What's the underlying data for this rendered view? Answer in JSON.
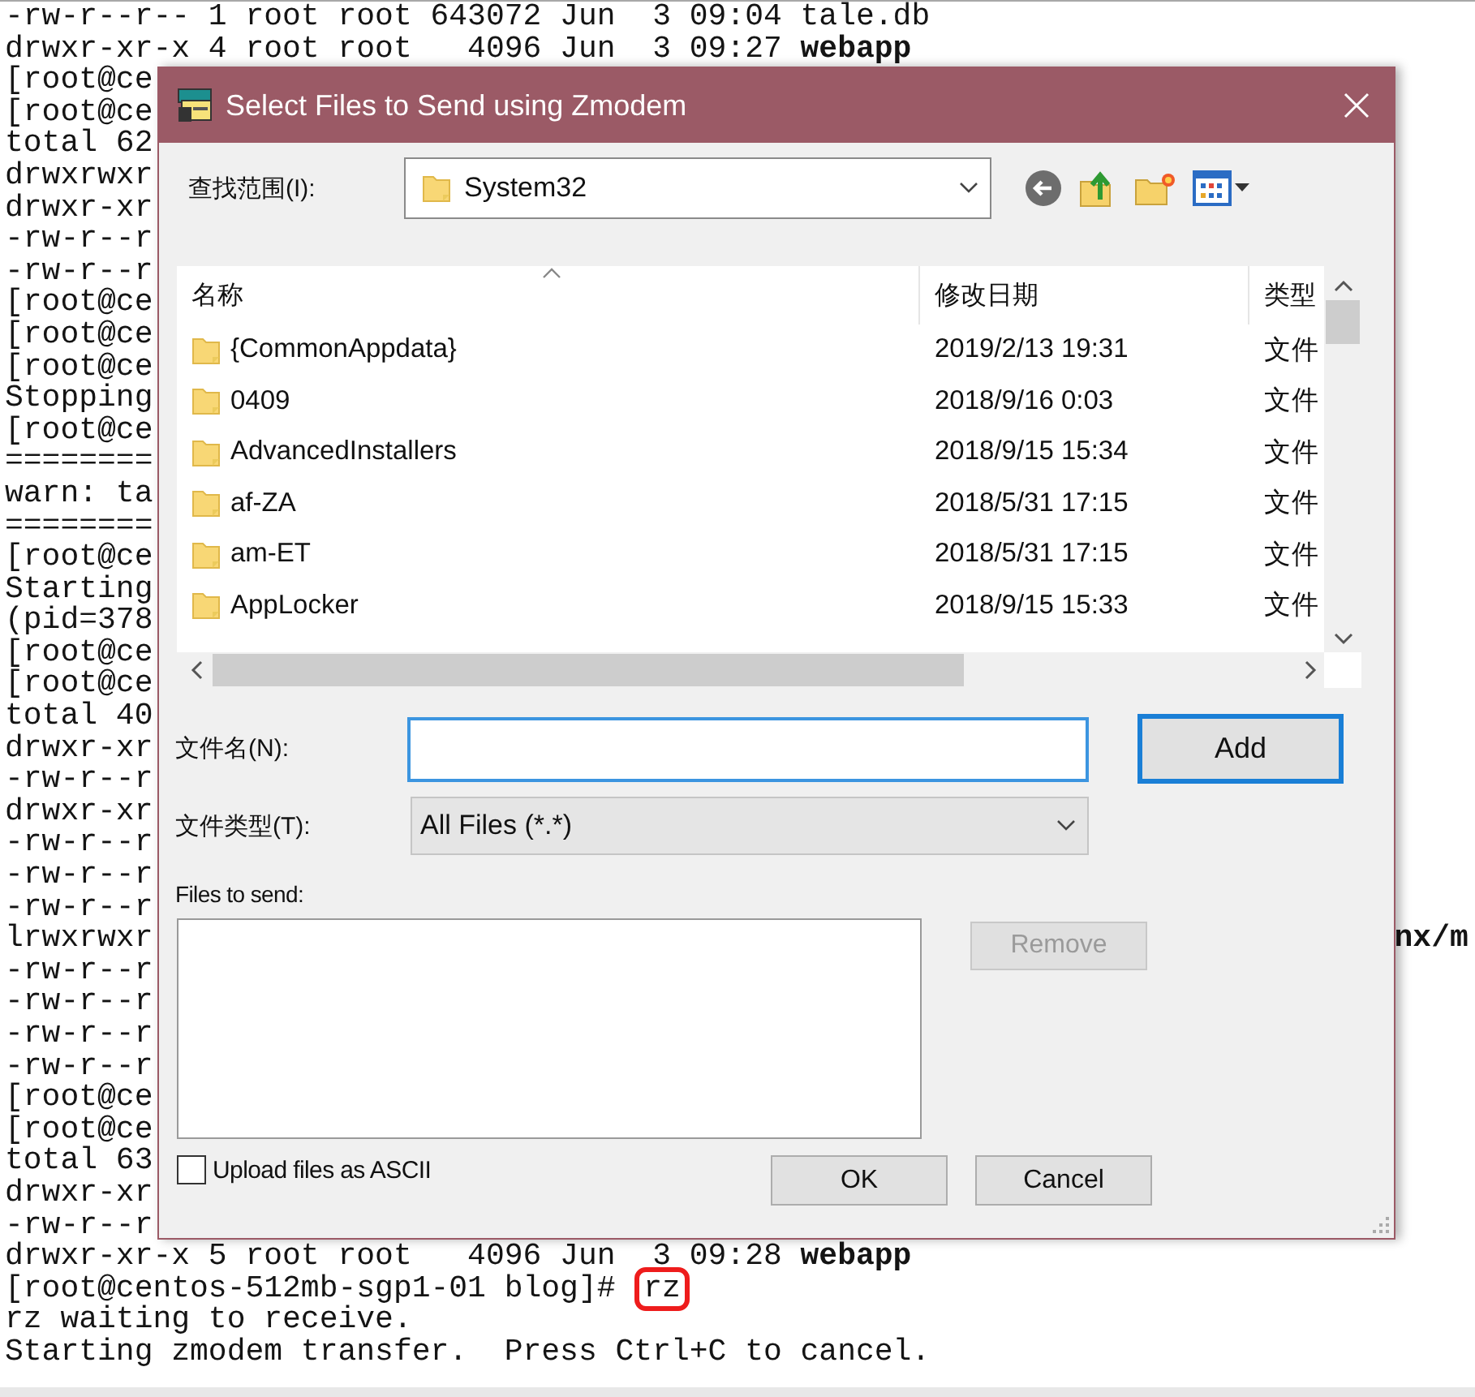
{
  "terminal": {
    "lines": [
      {
        "text": "-rw-r--r-- 1 root root 643072 Jun  3 09:04 tale.db"
      },
      {
        "text": "drwxr-xr-x 4 root root   4096 Jun  3 09:27 **webapp**"
      },
      {
        "text": "[root@ce"
      },
      {
        "text": "[root@ce"
      },
      {
        "text": "total 62"
      },
      {
        "text": "drwxrwxr"
      },
      {
        "text": "drwxr-xr"
      },
      {
        "text": "-rw-r--r"
      },
      {
        "text": "-rw-r--r"
      },
      {
        "text": "[root@ce"
      },
      {
        "text": "[root@ce"
      },
      {
        "text": "[root@ce"
      },
      {
        "text": "Stopping"
      },
      {
        "text": "[root@ce"
      },
      {
        "text": "========"
      },
      {
        "text": "warn: ta"
      },
      {
        "text": "========"
      },
      {
        "text": "[root@ce"
      },
      {
        "text": "Starting"
      },
      {
        "text": "(pid=378"
      },
      {
        "text": "[root@ce"
      },
      {
        "text": "[root@ce"
      },
      {
        "text": "total 40"
      },
      {
        "text": "drwxr-xr"
      },
      {
        "text": "-rw-r--r"
      },
      {
        "text": "drwxr-xr"
      },
      {
        "text": "-rw-r--r"
      },
      {
        "text": "-rw-r--r"
      },
      {
        "text": "-rw-r--r"
      },
      {
        "text": "lrwxrwxr",
        "right": "**nx/m**"
      },
      {
        "text": "-rw-r--r"
      },
      {
        "text": "-rw-r--r"
      },
      {
        "text": "-rw-r--r"
      },
      {
        "text": "-rw-r--r"
      },
      {
        "text": "[root@ce"
      },
      {
        "text": "[root@ce"
      },
      {
        "text": "total 63"
      },
      {
        "text": "drwxr-xr"
      },
      {
        "text": "-rw-r--r"
      },
      {
        "text": "drwxr-xr-x 5 root root   4096 Jun  3 09:28 **webapp**"
      },
      {
        "text": "[root@centos-512mb-sgp1-01 blog]# ",
        "boxed": "rz"
      },
      {
        "text": "rz waiting to receive."
      },
      {
        "text": "Starting zmodem transfer.  Press Ctrl+C to cancel."
      }
    ]
  },
  "dialog": {
    "title": "Select Files to Send using Zmodem",
    "look_in": {
      "label": "查找范围(I):",
      "value": "System32"
    },
    "file_list": {
      "columns": [
        "名称",
        "修改日期",
        "类型"
      ],
      "rows": [
        {
          "name": "{CommonAppdata}",
          "date": "2019/2/13 19:31",
          "type": "文件"
        },
        {
          "name": "0409",
          "date": "2018/9/16 0:03",
          "type": "文件"
        },
        {
          "name": "AdvancedInstallers",
          "date": "2018/9/15 15:34",
          "type": "文件"
        },
        {
          "name": "af-ZA",
          "date": "2018/5/31 17:15",
          "type": "文件"
        },
        {
          "name": "am-ET",
          "date": "2018/5/31 17:15",
          "type": "文件"
        },
        {
          "name": "AppLocker",
          "date": "2018/9/15 15:33",
          "type": "文件"
        }
      ]
    },
    "file_name": {
      "label": "文件名(N):",
      "focused": true
    },
    "add_button": {
      "label": "Add",
      "default": true
    },
    "file_type": {
      "label": "文件类型(T):",
      "value": "All Files (*.*)"
    },
    "files_to_send": {
      "label": "Files to send:"
    },
    "remove_button": {
      "label": "Remove",
      "disabled": true
    },
    "ascii_checkbox": {
      "label": "Upload files as ASCII",
      "checked": false
    },
    "ok_button": {
      "label": "OK",
      "disabled": false
    },
    "cancel_button": {
      "label": "Cancel",
      "disabled": false
    }
  }
}
